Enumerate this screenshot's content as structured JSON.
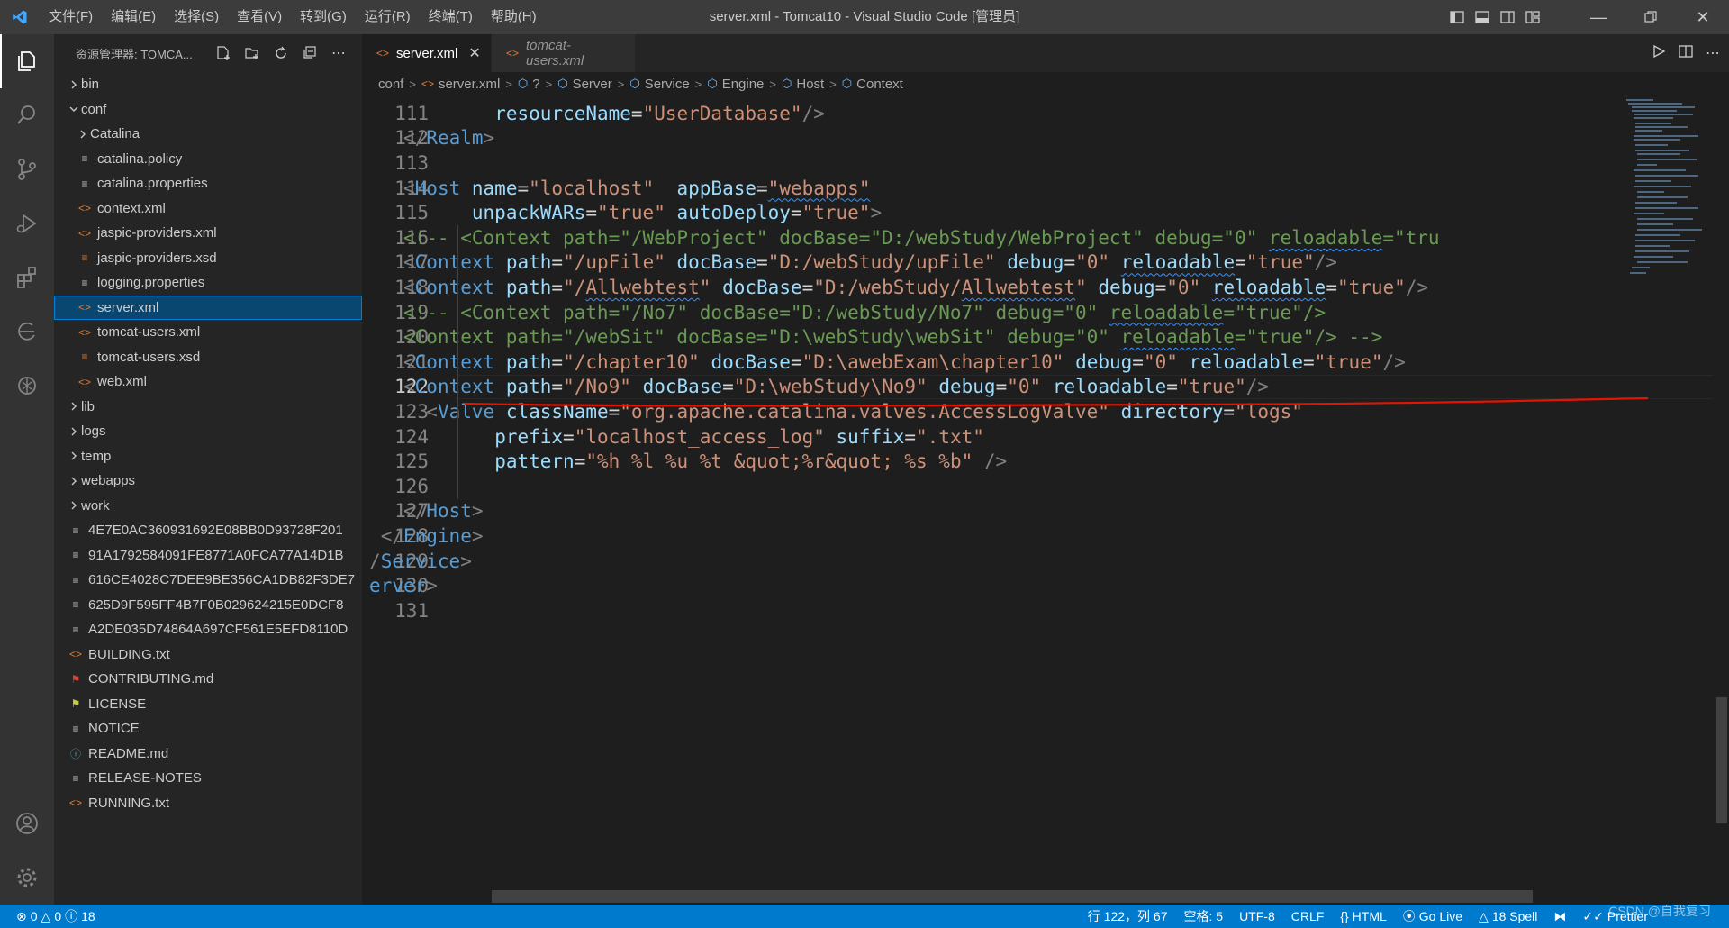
{
  "window": {
    "title": "server.xml - Tomcat10 - Visual Studio Code [管理员]"
  },
  "menu": [
    "文件(F)",
    "编辑(E)",
    "选择(S)",
    "查看(V)",
    "转到(G)",
    "运行(R)",
    "终端(T)",
    "帮助(H)"
  ],
  "explorer": {
    "title": "资源管理器: TOMCA...",
    "items": [
      {
        "label": "bin",
        "type": "folder",
        "expanded": false,
        "depth": 0
      },
      {
        "label": "conf",
        "type": "folder",
        "expanded": true,
        "depth": 0
      },
      {
        "label": "Catalina",
        "type": "folder",
        "expanded": false,
        "depth": 1
      },
      {
        "label": "catalina.policy",
        "type": "lines",
        "depth": 1
      },
      {
        "label": "catalina.properties",
        "type": "lines",
        "depth": 1
      },
      {
        "label": "context.xml",
        "type": "xml",
        "depth": 1
      },
      {
        "label": "jaspic-providers.xml",
        "type": "xml",
        "depth": 1
      },
      {
        "label": "jaspic-providers.xsd",
        "type": "xsd",
        "depth": 1
      },
      {
        "label": "logging.properties",
        "type": "lines",
        "depth": 1
      },
      {
        "label": "server.xml",
        "type": "xml",
        "depth": 1,
        "selected": true
      },
      {
        "label": "tomcat-users.xml",
        "type": "xml",
        "depth": 1
      },
      {
        "label": "tomcat-users.xsd",
        "type": "xsd",
        "depth": 1
      },
      {
        "label": "web.xml",
        "type": "xml",
        "depth": 1
      },
      {
        "label": "lib",
        "type": "folder",
        "expanded": false,
        "depth": 0
      },
      {
        "label": "logs",
        "type": "folder",
        "expanded": false,
        "depth": 0
      },
      {
        "label": "temp",
        "type": "folder",
        "expanded": false,
        "depth": 0
      },
      {
        "label": "webapps",
        "type": "folder",
        "expanded": false,
        "depth": 0
      },
      {
        "label": "work",
        "type": "folder",
        "expanded": false,
        "depth": 0
      },
      {
        "label": "4E7E0AC360931692E08BB0D93728F201",
        "type": "lines",
        "depth": 0
      },
      {
        "label": "91A1792584091FE8771A0FCA77A14D1B",
        "type": "lines",
        "depth": 0
      },
      {
        "label": "616CE4028C7DEE9BE356CA1DB82F3DE7",
        "type": "lines",
        "depth": 0
      },
      {
        "label": "625D9F595FF4B7F0B029624215E0DCF8",
        "type": "lines",
        "depth": 0
      },
      {
        "label": "A2DE035D74864A697CF561E5EFD8110D",
        "type": "lines",
        "depth": 0
      },
      {
        "label": "BUILDING.txt",
        "type": "xml",
        "depth": 0
      },
      {
        "label": "CONTRIBUTING.md",
        "type": "md",
        "depth": 0
      },
      {
        "label": "LICENSE",
        "type": "lic",
        "depth": 0
      },
      {
        "label": "NOTICE",
        "type": "lines",
        "depth": 0
      },
      {
        "label": "README.md",
        "type": "info",
        "depth": 0
      },
      {
        "label": "RELEASE-NOTES",
        "type": "lines",
        "depth": 0
      },
      {
        "label": "RUNNING.txt",
        "type": "xml",
        "depth": 0
      }
    ]
  },
  "tabs": [
    {
      "label": "server.xml",
      "active": true
    },
    {
      "label": "tomcat-users.xml",
      "active": false
    }
  ],
  "breadcrumb": [
    "conf",
    "server.xml",
    "?",
    "Server",
    "Service",
    "Engine",
    "Host",
    "Context"
  ],
  "editor": {
    "current_line": 122,
    "lines": [
      {
        "n": "111",
        "indent": 8,
        "parts": [
          [
            "attr",
            "resourceName"
          ],
          [
            "txt",
            "="
          ],
          [
            "str",
            "\"UserDatabase\""
          ],
          [
            "brk",
            "/>"
          ]
        ]
      },
      {
        "n": "112",
        "indent": 0,
        "parts": [
          [
            "brk",
            "</"
          ],
          [
            "tag",
            "Realm"
          ],
          [
            "brk",
            ">"
          ]
        ]
      },
      {
        "n": "113",
        "indent": 0,
        "parts": []
      },
      {
        "n": "114",
        "indent": 0,
        "parts": [
          [
            "brk",
            "<"
          ],
          [
            "tag",
            "Host"
          ],
          [
            "txt",
            " "
          ],
          [
            "attr",
            "name"
          ],
          [
            "txt",
            "="
          ],
          [
            "str",
            "\"localhost\""
          ],
          [
            "txt",
            "  "
          ],
          [
            "attr",
            "appBase"
          ],
          [
            "txt",
            "="
          ],
          [
            "str",
            "\"webapps\"",
            "squig"
          ]
        ]
      },
      {
        "n": "115",
        "indent": 6,
        "parts": [
          [
            "attr",
            "unpackWARs"
          ],
          [
            "txt",
            "="
          ],
          [
            "str",
            "\"true\""
          ],
          [
            "txt",
            " "
          ],
          [
            "attr",
            "autoDeploy"
          ],
          [
            "txt",
            "="
          ],
          [
            "str",
            "\"true\""
          ],
          [
            "brk",
            ">"
          ]
        ]
      },
      {
        "n": "116",
        "indent": 0,
        "parts": [
          [
            "com",
            "<!-- <Context path=\"/WebProject\" docBase=\"D:/webStudy/WebProject\" debug=\"0\" "
          ],
          [
            "com",
            "reloadable",
            "squig"
          ],
          [
            "com",
            "=\"tru"
          ]
        ]
      },
      {
        "n": "117",
        "indent": 0,
        "parts": [
          [
            "brk",
            "<"
          ],
          [
            "tag",
            "Context"
          ],
          [
            "txt",
            " "
          ],
          [
            "attr",
            "path"
          ],
          [
            "txt",
            "="
          ],
          [
            "str",
            "\"/upFile\""
          ],
          [
            "txt",
            " "
          ],
          [
            "attr",
            "docBase"
          ],
          [
            "txt",
            "="
          ],
          [
            "str",
            "\"D:/webStudy/upFile\""
          ],
          [
            "txt",
            " "
          ],
          [
            "attr",
            "debug"
          ],
          [
            "txt",
            "="
          ],
          [
            "str",
            "\"0\""
          ],
          [
            "txt",
            " "
          ],
          [
            "attr",
            "reloadable",
            "squig"
          ],
          [
            "txt",
            "="
          ],
          [
            "str",
            "\"true\""
          ],
          [
            "brk",
            "/>"
          ]
        ]
      },
      {
        "n": "118",
        "indent": 0,
        "parts": [
          [
            "brk",
            "<"
          ],
          [
            "tag",
            "Context"
          ],
          [
            "txt",
            " "
          ],
          [
            "attr",
            "path"
          ],
          [
            "txt",
            "="
          ],
          [
            "str",
            "\"/"
          ],
          [
            "str",
            "Allwebtest",
            "squig"
          ],
          [
            "str",
            "\""
          ],
          [
            "txt",
            " "
          ],
          [
            "attr",
            "docBase"
          ],
          [
            "txt",
            "="
          ],
          [
            "str",
            "\"D:/webStudy/"
          ],
          [
            "str",
            "Allwebtest",
            "squig"
          ],
          [
            "str",
            "\""
          ],
          [
            "txt",
            " "
          ],
          [
            "attr",
            "debug"
          ],
          [
            "txt",
            "="
          ],
          [
            "str",
            "\"0\""
          ],
          [
            "txt",
            " "
          ],
          [
            "attr",
            "reloadable",
            "squig"
          ],
          [
            "txt",
            "="
          ],
          [
            "str",
            "\"true\""
          ],
          [
            "brk",
            "/>"
          ]
        ]
      },
      {
        "n": "119",
        "indent": 0,
        "parts": [
          [
            "com",
            "<!-- <Context path=\"/No7\" docBase=\"D:/webStudy/No7\" debug=\"0\" "
          ],
          [
            "com",
            "reloadable",
            "squig"
          ],
          [
            "com",
            "=\"true\"/>"
          ]
        ]
      },
      {
        "n": "120",
        "indent": 0,
        "parts": [
          [
            "com",
            "<Context path=\"/webSit\" docBase=\"D:\\webStudy\\webSit\" debug=\"0\" "
          ],
          [
            "com",
            "reloadable",
            "squig"
          ],
          [
            "com",
            "=\"true\"/> -->"
          ]
        ]
      },
      {
        "n": "121",
        "indent": 0,
        "parts": [
          [
            "brk",
            "<"
          ],
          [
            "tag",
            "Context"
          ],
          [
            "txt",
            " "
          ],
          [
            "attr",
            "path"
          ],
          [
            "txt",
            "="
          ],
          [
            "str",
            "\"/chapter10\""
          ],
          [
            "txt",
            " "
          ],
          [
            "attr",
            "docBase"
          ],
          [
            "txt",
            "="
          ],
          [
            "str",
            "\"D:\\awebExam\\chapter10\""
          ],
          [
            "txt",
            " "
          ],
          [
            "attr",
            "debug"
          ],
          [
            "txt",
            "="
          ],
          [
            "str",
            "\"0\""
          ],
          [
            "txt",
            " "
          ],
          [
            "attr",
            "reloadable"
          ],
          [
            "txt",
            "="
          ],
          [
            "str",
            "\"true\""
          ],
          [
            "brk",
            "/>"
          ]
        ]
      },
      {
        "n": "122",
        "indent": 0,
        "parts": [
          [
            "brk",
            "<"
          ],
          [
            "tag",
            "Context"
          ],
          [
            "txt",
            " "
          ],
          [
            "attr",
            "path"
          ],
          [
            "txt",
            "="
          ],
          [
            "str",
            "\"/No9\""
          ],
          [
            "txt",
            " "
          ],
          [
            "attr",
            "docBase"
          ],
          [
            "txt",
            "="
          ],
          [
            "str",
            "\"D:\\webStudy\\No9\""
          ],
          [
            "txt",
            " "
          ],
          [
            "attr",
            "debug"
          ],
          [
            "txt",
            "="
          ],
          [
            "str",
            "\"0\""
          ],
          [
            "txt",
            " "
          ],
          [
            "attr",
            "reloadable"
          ],
          [
            "txt",
            "="
          ],
          [
            "str",
            "\"true\""
          ],
          [
            "brk",
            "/>"
          ]
        ]
      },
      {
        "n": "123",
        "indent": 2,
        "parts": [
          [
            "brk",
            "<"
          ],
          [
            "tag",
            "Valve"
          ],
          [
            "txt",
            " "
          ],
          [
            "attr",
            "className"
          ],
          [
            "txt",
            "="
          ],
          [
            "str",
            "\"org.apache.catalina.valves.AccessLogValve\""
          ],
          [
            "txt",
            " "
          ],
          [
            "attr",
            "directory"
          ],
          [
            "txt",
            "="
          ],
          [
            "str",
            "\"logs\""
          ]
        ]
      },
      {
        "n": "124",
        "indent": 8,
        "parts": [
          [
            "attr",
            "prefix"
          ],
          [
            "txt",
            "="
          ],
          [
            "str",
            "\"localhost_access_log\""
          ],
          [
            "txt",
            " "
          ],
          [
            "attr",
            "suffix"
          ],
          [
            "txt",
            "="
          ],
          [
            "str",
            "\".txt\""
          ]
        ]
      },
      {
        "n": "125",
        "indent": 8,
        "parts": [
          [
            "attr",
            "pattern"
          ],
          [
            "txt",
            "="
          ],
          [
            "str",
            "\"%h %l %u %t &quot;%r&quot; %s %b\""
          ],
          [
            "txt",
            " "
          ],
          [
            "brk",
            "/>"
          ]
        ]
      },
      {
        "n": "126",
        "indent": 0,
        "parts": []
      },
      {
        "n": "127",
        "indent": 0,
        "parts": [
          [
            "brk",
            "</"
          ],
          [
            "tag",
            "Host"
          ],
          [
            "brk",
            ">"
          ]
        ]
      },
      {
        "n": "128",
        "indent": -2,
        "parts": [
          [
            "brk",
            "</"
          ],
          [
            "tag",
            "Engine"
          ],
          [
            "brk",
            ">"
          ]
        ]
      },
      {
        "n": "129",
        "indent": -3,
        "parts": [
          [
            "brk",
            "/"
          ],
          [
            "tag",
            "Service"
          ],
          [
            "brk",
            ">"
          ]
        ]
      },
      {
        "n": "130",
        "indent": -3,
        "parts": [
          [
            "tag",
            "erver"
          ],
          [
            "brk",
            ">"
          ]
        ]
      },
      {
        "n": "131",
        "indent": 0,
        "parts": []
      }
    ]
  },
  "statusbar": {
    "errors": "0",
    "warnings": "0",
    "infos": "18",
    "position": "行 122，列 67",
    "spaces": "空格: 5",
    "encoding": "UTF-8",
    "eol": "CRLF",
    "language": "HTML",
    "golive": "Go Live",
    "spell": "18 Spell",
    "prettier": "Prettier"
  },
  "watermark": "CSDN @自我复习",
  "colors": {
    "accent": "#007acc",
    "selection": "#094771",
    "annotation": "#e51400"
  }
}
